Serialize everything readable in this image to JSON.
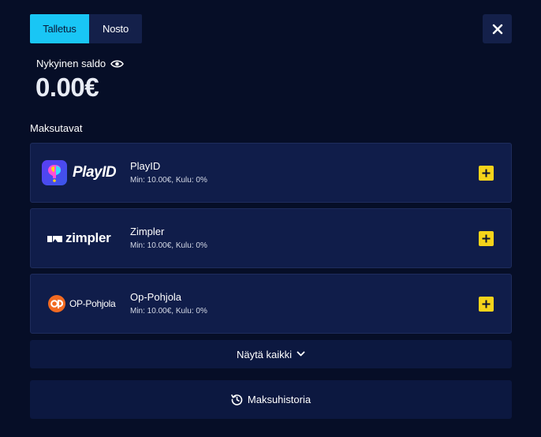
{
  "tabs": [
    {
      "label": "Talletus",
      "active": true
    },
    {
      "label": "Nosto",
      "active": false
    }
  ],
  "balance": {
    "label": "Nykyinen saldo",
    "amount": "0.00€"
  },
  "section_title": "Maksutavat",
  "payment_methods": [
    {
      "logo_text": "PlayID",
      "name": "PlayID",
      "info": "Min: 10.00€, Kulu: 0%",
      "icon": "playid-logo-icon"
    },
    {
      "logo_text": "zimpler",
      "name": "Zimpler",
      "info": "Min: 10.00€, Kulu: 0%",
      "icon": "zimpler-logo-icon"
    },
    {
      "logo_text": "OP-Pohjola",
      "name": "Op-Pohjola",
      "info": "Min: 10.00€, Kulu: 0%",
      "icon": "op-logo-icon"
    }
  ],
  "show_all_label": "Näytä kaikki",
  "history_label": "Maksuhistoria",
  "colors": {
    "background": "#060e27",
    "card": "#101d4a",
    "accent": "#19c6f5",
    "plus": "#f5d31a",
    "op_orange": "#f26a21"
  }
}
